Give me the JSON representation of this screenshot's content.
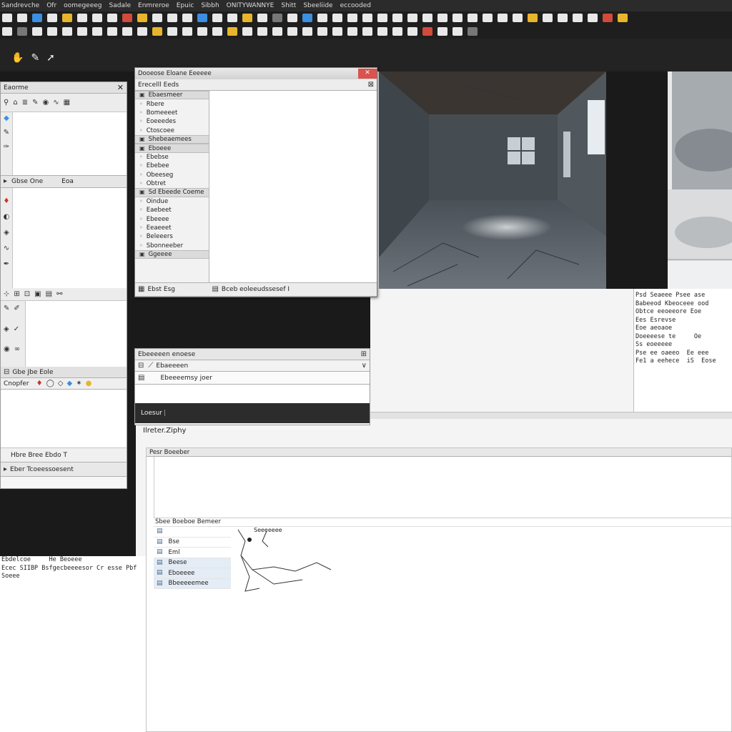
{
  "menubar": {
    "items": [
      "Sandrevche",
      "Ofr",
      "oomegeeeg",
      "Sadale",
      "Enmreroe",
      "Epuic",
      "Sibbh",
      "ONITYWANNYE",
      "Shitt",
      "Sbeeliide",
      "eccooded"
    ]
  },
  "toolbar_icons": {
    "row1": [
      "w",
      "w",
      "b",
      "w",
      "y",
      "w",
      "w",
      "w",
      "r",
      "y",
      "w",
      "w",
      "w",
      "b",
      "w",
      "w",
      "y",
      "w",
      "k",
      "w",
      "b",
      "w",
      "w",
      "w",
      "w",
      "w",
      "w",
      "w",
      "w",
      "w",
      "w",
      "w",
      "w",
      "w",
      "w",
      "y",
      "w",
      "w",
      "w",
      "w",
      "r",
      "y"
    ],
    "row2": [
      "w",
      "k",
      "w",
      "w",
      "w",
      "w",
      "w",
      "w",
      "w",
      "w",
      "y",
      "w",
      "w",
      "w",
      "w",
      "y",
      "w",
      "w",
      "w",
      "w",
      "w",
      "w",
      "w",
      "w",
      "w",
      "w",
      "w",
      "w",
      "r",
      "w",
      "w",
      "k"
    ]
  },
  "left_panel": {
    "title": "Eaorme",
    "close": "✕",
    "row_label": "Gbse One",
    "row_value": "Eoa",
    "group_label": "Gbe Jbe Eole",
    "props_label": "Cnopfer",
    "bottom_label": "Hbre Bree Ebdo T",
    "status_label": "Eber Tcoeessoesent"
  },
  "dialog": {
    "title": "Dooeose Eloane Eeeeee",
    "subtitle": "Erecelll Eeds",
    "close": "✕",
    "items": [
      {
        "label": "Ebaesmeer",
        "kind": "sec"
      },
      {
        "label": "Rbere",
        "kind": "item"
      },
      {
        "label": "Bomeeeet",
        "kind": "item"
      },
      {
        "label": "Eoeeedes",
        "kind": "item"
      },
      {
        "label": "Ctoscoee",
        "kind": "item"
      },
      {
        "label": "Shebeaemees",
        "kind": "sec"
      },
      {
        "label": "Eboeee",
        "kind": "sec"
      },
      {
        "label": "Ebebse",
        "kind": "item"
      },
      {
        "label": "Ebebee",
        "kind": "item"
      },
      {
        "label": "Obeeseg",
        "kind": "item"
      },
      {
        "label": "Obtret",
        "kind": "item"
      },
      {
        "label": "Sd Ebeede Coeme",
        "kind": "sec"
      },
      {
        "label": "Oindue",
        "kind": "item"
      },
      {
        "label": "Eaebeet",
        "kind": "item"
      },
      {
        "label": "Ebeeee",
        "kind": "item"
      },
      {
        "label": "Eeaeeet",
        "kind": "item"
      },
      {
        "label": "Beleeers",
        "kind": "item"
      },
      {
        "label": "Sbonneeber",
        "kind": "item"
      },
      {
        "label": "Ggeeee",
        "kind": "sec"
      }
    ],
    "footer_left": "Ebst Esg",
    "footer_right": "Bceb eoleeudssesef I"
  },
  "layers": {
    "title": "Ebeeeeen enoese",
    "item1": "Ebaeeeen",
    "item2": "Ebeeeemsy joer",
    "dark_label": "Loesur"
  },
  "right_text": {
    "lines": [
      "Psd Seaeee Psee ase",
      "Babeeod Kbeoceee ood",
      "Obtce eeoeeore Eoe",
      "Ees Esrevse",
      "Eoe aeoaoe",
      "Doeeeese te     Oe",
      "Ss eoeeeee",
      "Pse ee oaeeo  Ee eee",
      "Fe1 a eehece  iS  Eose"
    ]
  },
  "bottom": {
    "label": "Ilreter.Ziphy",
    "panel_title": "Pesr Boeeber",
    "list_title": "Sbee Boeboe Bemeer",
    "list_items": [
      "",
      "Bse",
      "Eml",
      "Beese",
      "Eboeeee",
      "Bbeeeeemee"
    ],
    "map_label": "Seeeeeee"
  },
  "left_bottom_text": {
    "lines": [
      "Ebdelcoe     He Beoeee",
      "Ecec SIIBP Bsfgecbeeeesor Cr esse Pbf",
      "Soeee"
    ]
  }
}
